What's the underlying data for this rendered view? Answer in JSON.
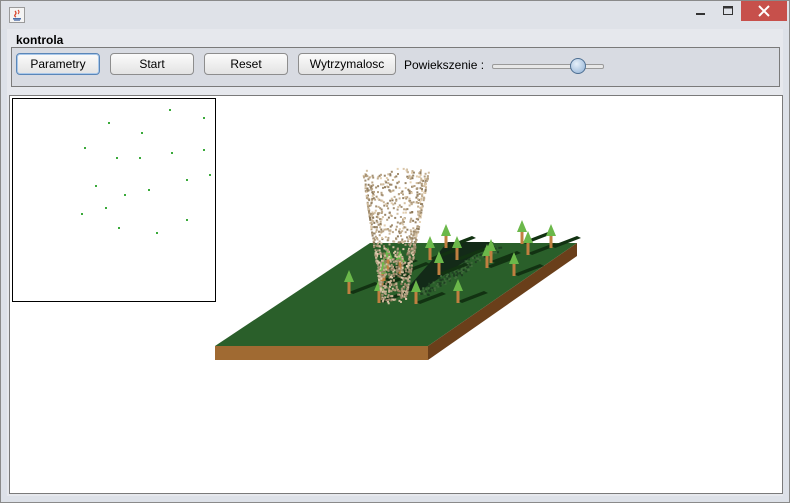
{
  "window": {
    "title": ""
  },
  "control": {
    "group_title": "kontrola",
    "buttons": {
      "params": "Parametry",
      "start": "Start",
      "reset": "Reset",
      "durability": "Wytrzymalosc"
    },
    "zoom_label": "Powiekszenie :",
    "zoom_level": 0.75
  },
  "colors": {
    "grass": "#2a5f2a",
    "soil": "#a06a32",
    "trunk": "#c08040",
    "leaf": "#6bb84a",
    "tornado": "#a08468",
    "minimap_tree": "#3aaa3a"
  },
  "icons": {
    "app": "java-icon"
  }
}
